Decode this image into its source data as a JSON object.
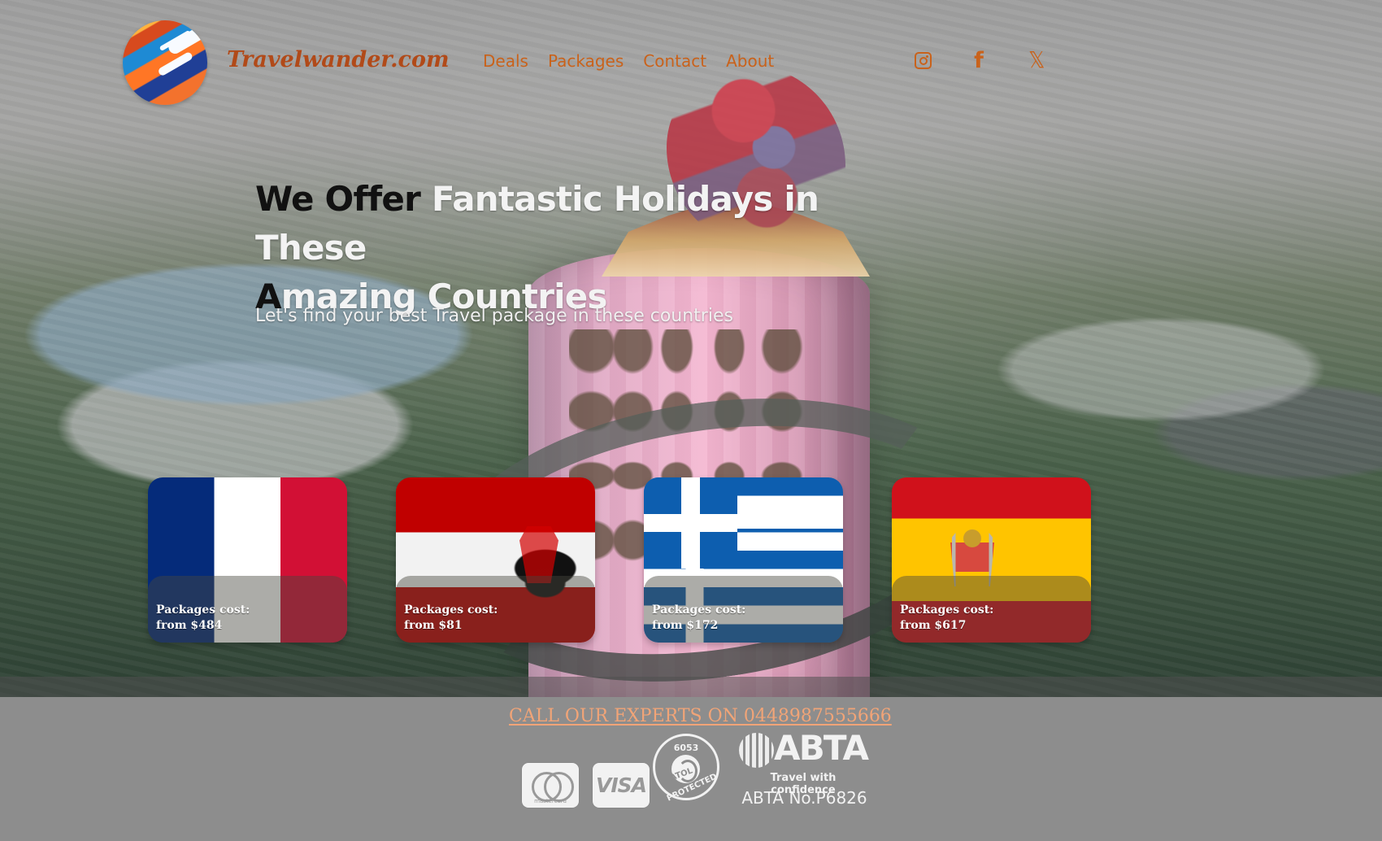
{
  "site": {
    "name": "Travelwander.com",
    "logo_icon": "globe-airplane-icon"
  },
  "navigation": {
    "items": [
      {
        "label": "Deals"
      },
      {
        "label": "Packages"
      },
      {
        "label": "Contact"
      },
      {
        "label": "About"
      }
    ]
  },
  "social": {
    "instagram_icon": "instagram-icon",
    "facebook_icon": "facebook-icon",
    "x_icon": "x-icon"
  },
  "hero": {
    "headline_part_1": "We Offer ",
    "headline_part_2": "Fantastic Holidays in These",
    "headline_part_3": "A",
    "headline_part_4": "mazing Countries",
    "subheading": "Let's find your best Travel package in these countries"
  },
  "packages": [
    {
      "country_icon": "france-flag",
      "price_label": "Packages cost:",
      "price": "from $484"
    },
    {
      "country_icon": "austria-flag",
      "price_label": "Packages cost:",
      "price": "from $81"
    },
    {
      "country_icon": "greece-flag",
      "price_label": "Packages cost:",
      "price": "from $172"
    },
    {
      "country_icon": "spain-flag",
      "price_label": "Packages cost:",
      "price": "from $617"
    }
  ],
  "footer": {
    "call_to_action": "CALL OUR EXPERTS ON 0448987555666",
    "mastercard_label": "mastercard",
    "visa_label": "VISA",
    "atol_number": "6053",
    "atol_label": "ATOL",
    "atol_protected": "PROTECTED",
    "abta_title": "ABTA",
    "abta_tagline": "Travel with confidence",
    "abta_number": "ABTA No.P6826"
  },
  "colors": {
    "accent": "#c9621b",
    "brand": "#b14a19",
    "footer_background": "#8d8d8d",
    "footer_link": "#f1a477"
  }
}
